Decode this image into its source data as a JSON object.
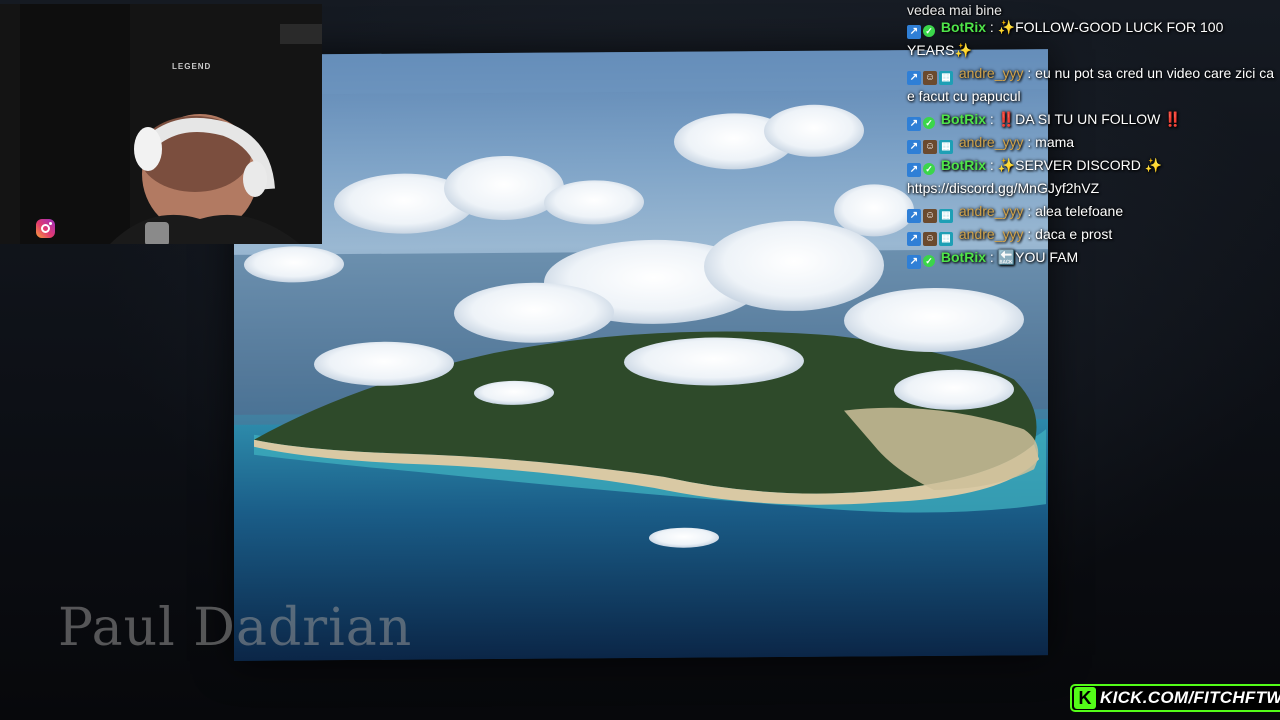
{
  "webcam": {
    "brand_label": "LEGEND",
    "social_icon": "instagram-icon"
  },
  "watermark": "Paul Dadrian",
  "chat": {
    "top_cut_text": "vedea mai bine",
    "messages": [
      {
        "user": "BotRix",
        "user_type": "bot",
        "badges": [
          "blue-badge-icon",
          "verified-check-icon"
        ],
        "prefix": "✨",
        "text": "FOLLOW-GOOD LUCK FOR 100 YEARS✨"
      },
      {
        "user": "andre_yyy",
        "user_type": "viewer",
        "badges": [
          "blue-badge-icon",
          "cat-badge-icon",
          "teal-badge-icon"
        ],
        "prefix": "",
        "text": "eu nu pot sa cred un video care zici ca e facut cu papucul"
      },
      {
        "user": "BotRix",
        "user_type": "bot",
        "badges": [
          "blue-badge-icon",
          "verified-check-icon"
        ],
        "prefix": "‼️",
        "text": "DA SI TU UN FOLLOW ‼️"
      },
      {
        "user": "andre_yyy",
        "user_type": "viewer",
        "badges": [
          "blue-badge-icon",
          "cat-badge-icon",
          "teal-badge-icon"
        ],
        "prefix": "",
        "text": "mama"
      },
      {
        "user": "BotRix",
        "user_type": "bot",
        "badges": [
          "blue-badge-icon",
          "verified-check-icon"
        ],
        "prefix": "✨",
        "text": "SERVER DISCORD ✨ https://discord.gg/MnGJyf2hVZ"
      },
      {
        "user": "andre_yyy",
        "user_type": "viewer",
        "badges": [
          "blue-badge-icon",
          "cat-badge-icon",
          "teal-badge-icon"
        ],
        "prefix": "",
        "text": "alea telefoane"
      },
      {
        "user": "andre_yyy",
        "user_type": "viewer",
        "badges": [
          "blue-badge-icon",
          "cat-badge-icon",
          "teal-badge-icon"
        ],
        "prefix": "",
        "text": "daca e prost"
      },
      {
        "user": "BotRix",
        "user_type": "bot",
        "badges": [
          "blue-badge-icon",
          "verified-check-icon"
        ],
        "prefix": "🔙",
        "text": "YOU FAM"
      }
    ]
  },
  "kick": {
    "logo_letter": "K",
    "url_text": "KICK.COM/FITCHFTW",
    "brand_color": "#53fc18"
  }
}
